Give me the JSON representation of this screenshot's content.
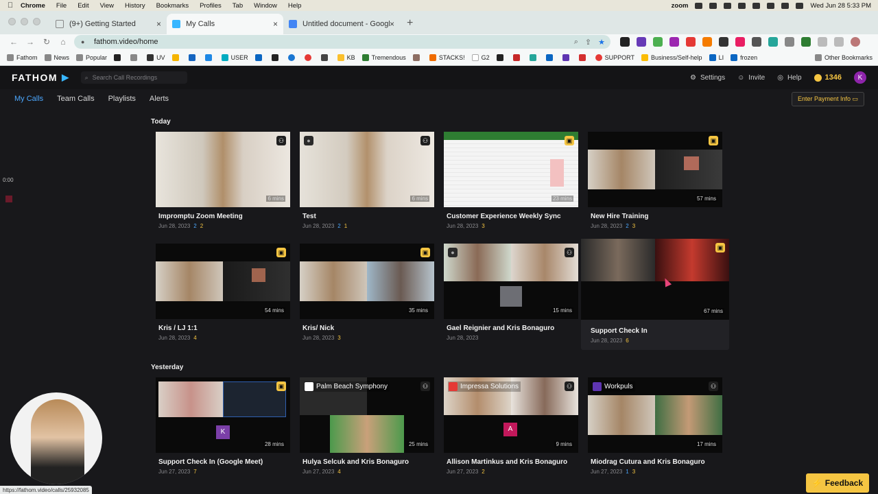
{
  "macos_menubar": {
    "app": "Chrome",
    "menus": [
      "File",
      "Edit",
      "View",
      "History",
      "Bookmarks",
      "Profiles",
      "Tab",
      "Window",
      "Help"
    ],
    "zoom_label": "zoom",
    "clock": "Wed Jun 28  5:33 PM"
  },
  "browser": {
    "tabs": [
      {
        "title": "(9+) Getting Started",
        "active": false
      },
      {
        "title": "My Calls",
        "active": true
      },
      {
        "title": "Untitled document - Google Docs",
        "active": false
      }
    ],
    "url": "fathom.video/home",
    "bookmarks": [
      "Fathom",
      "News",
      "Popular",
      "UV",
      "USER",
      "KB",
      "Tremendous",
      "STACKS!",
      "G2",
      "SUPPORT",
      "Business/Self-help",
      "LI",
      "frozen"
    ],
    "other_bookmarks": "Other Bookmarks",
    "status_url": "https://fathom.video/calls/25932085"
  },
  "app": {
    "logo": "FATHOM",
    "search_placeholder": "Search Call Recordings",
    "settings": "Settings",
    "invite": "Invite",
    "help": "Help",
    "points": "1346",
    "avatar_initial": "K",
    "tabs": [
      "My Calls",
      "Team Calls",
      "Playlists",
      "Alerts"
    ],
    "payment": "Enter Payment Info",
    "feedback": "Feedback",
    "left_timer": "0:00"
  },
  "sections": {
    "today": "Today",
    "yesterday": "Yesterday"
  },
  "calls": [
    {
      "title": "Impromptu Zoom Meeting",
      "date": "Jun 28, 2023",
      "m1": "2",
      "m2": "2",
      "duration": "6 mins"
    },
    {
      "title": "Test",
      "date": "Jun 28, 2023",
      "m1": "2",
      "m2": "1",
      "duration": "6 mins"
    },
    {
      "title": "Customer Experience Weekly Sync",
      "date": "Jun 28, 2023",
      "m1": "",
      "m2": "3",
      "duration": "23 mins"
    },
    {
      "title": "New Hire Training",
      "date": "Jun 28, 2023",
      "m1": "2",
      "m2": "3",
      "duration": "57 mins"
    },
    {
      "title": "Kris / LJ 1:1",
      "date": "Jun 28, 2023",
      "m1": "",
      "m2": "4",
      "duration": "54 mins"
    },
    {
      "title": "Kris/ Nick",
      "date": "Jun 28, 2023",
      "m1": "",
      "m2": "3",
      "duration": "35 mins"
    },
    {
      "title": "Gael Reignier and Kris Bonaguro",
      "date": "Jun 28, 2023",
      "m1": "",
      "m2": "",
      "duration": "15 mins"
    },
    {
      "title": "Support Check In",
      "date": "Jun 28, 2023",
      "m1": "",
      "m2": "6",
      "duration": "67 mins"
    },
    {
      "title": "Support Check In (Google Meet)",
      "date": "Jun 27, 2023",
      "m1": "",
      "m2": "7",
      "duration": "28 mins"
    },
    {
      "title": "Hulya Selcuk and Kris Bonaguro",
      "date": "Jun 27, 2023",
      "m1": "",
      "m2": "4",
      "duration": "25 mins",
      "company": "Palm Beach Symphony"
    },
    {
      "title": "Allison Martinkus and Kris Bonaguro",
      "date": "Jun 27, 2023",
      "m1": "",
      "m2": "2",
      "duration": "9 mins",
      "company": "Impressa Solutions"
    },
    {
      "title": "Miodrag Cutura and Kris Bonaguro",
      "date": "Jun 27, 2023",
      "m1": "1",
      "m2": "3",
      "duration": "17 mins",
      "company": "Workpuls"
    }
  ]
}
